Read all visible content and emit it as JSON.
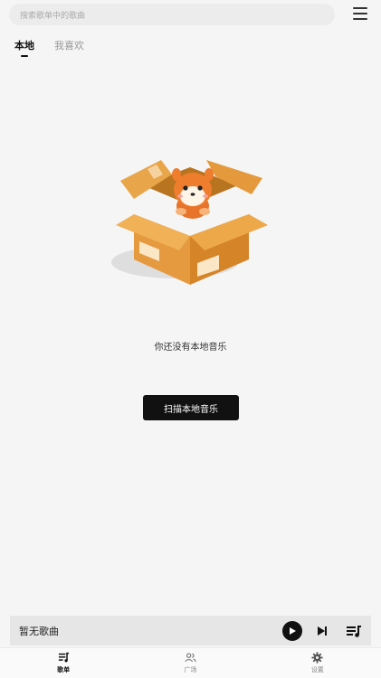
{
  "search": {
    "placeholder": "搜索歌单中的歌曲"
  },
  "tabs": [
    {
      "label": "本地",
      "active": true
    },
    {
      "label": "我喜欢",
      "active": false
    }
  ],
  "empty_state": {
    "message": "你还没有本地音乐",
    "scan_button": "扫描本地音乐"
  },
  "player": {
    "title": "暂无歌曲"
  },
  "nav": [
    {
      "label": "歌单",
      "icon": "playlist-icon",
      "active": true
    },
    {
      "label": "广场",
      "icon": "people-icon",
      "active": false
    },
    {
      "label": "设置",
      "icon": "gear-icon",
      "active": false
    }
  ]
}
